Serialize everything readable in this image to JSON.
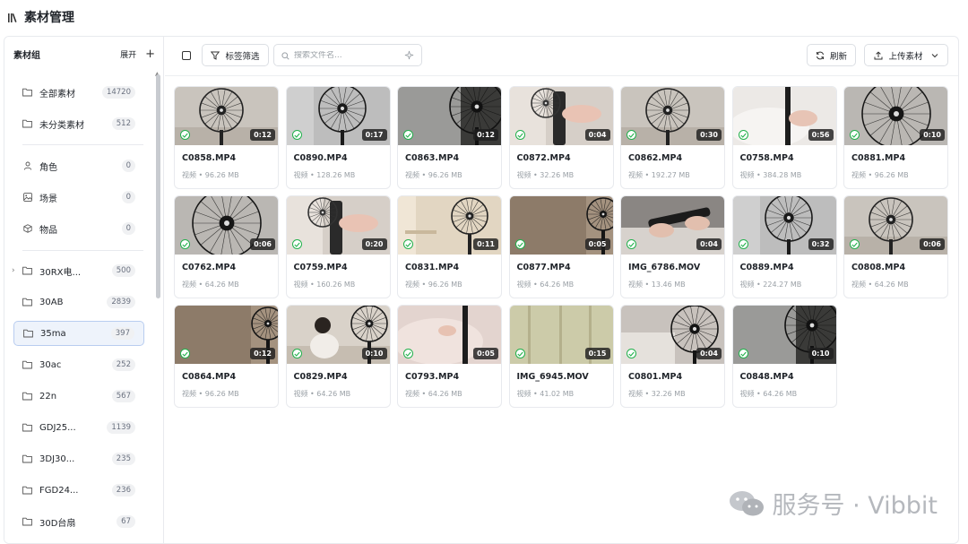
{
  "header": {
    "title": "素材管理"
  },
  "sidebar": {
    "title": "素材组",
    "expand_label": "展开",
    "add_label": "+",
    "items": [
      {
        "label": "全部素材",
        "count": "14720",
        "icon": "folder-icon"
      },
      {
        "label": "未分类素材",
        "count": "512",
        "icon": "folder-icon"
      },
      {
        "label": "角色",
        "count": "0",
        "icon": "person-icon"
      },
      {
        "label": "场景",
        "count": "0",
        "icon": "image-icon"
      },
      {
        "label": "物品",
        "count": "0",
        "icon": "box-icon"
      },
      {
        "label": "30RX电...",
        "count": "500",
        "icon": "folder-icon",
        "expandable": true
      },
      {
        "label": "30AB",
        "count": "2839",
        "icon": "folder-icon"
      },
      {
        "label": "35ma",
        "count": "397",
        "icon": "folder-icon",
        "active": true
      },
      {
        "label": "30ac",
        "count": "252",
        "icon": "folder-icon"
      },
      {
        "label": "22n",
        "count": "567",
        "icon": "folder-icon"
      },
      {
        "label": "GDJ25...",
        "count": "1139",
        "icon": "folder-icon"
      },
      {
        "label": "3DJ30...",
        "count": "235",
        "icon": "folder-icon"
      },
      {
        "label": "FGD24...",
        "count": "236",
        "icon": "folder-icon"
      },
      {
        "label": "30D台扇",
        "count": "67",
        "icon": "folder-icon"
      }
    ]
  },
  "toolbar": {
    "filter_label": "标签筛选",
    "search_placeholder": "搜索文件名...",
    "refresh_label": "刷新",
    "upload_label": "上传素材"
  },
  "cards": [
    {
      "name": "C0858.MP4",
      "meta": "视频 • 96.26 MB",
      "duration": "0:12",
      "scene": "fan-room"
    },
    {
      "name": "C0890.MP4",
      "meta": "视频 • 128.26 MB",
      "duration": "0:17",
      "scene": "fan-gray"
    },
    {
      "name": "C0863.MP4",
      "meta": "视频 • 96.26 MB",
      "duration": "0:12",
      "scene": "fan-dark"
    },
    {
      "name": "C0872.MP4",
      "meta": "视频 • 32.26 MB",
      "duration": "0:04",
      "scene": "hand-fan"
    },
    {
      "name": "C0862.MP4",
      "meta": "视频 • 192.27 MB",
      "duration": "0:30",
      "scene": "fan-room"
    },
    {
      "name": "C0758.MP4",
      "meta": "视频 • 384.28 MB",
      "duration": "0:56",
      "scene": "bed-pole"
    },
    {
      "name": "C0881.MP4",
      "meta": "视频 • 96.26 MB",
      "duration": "0:10",
      "scene": "fan-close"
    },
    {
      "name": "C0762.MP4",
      "meta": "视频 • 64.26 MB",
      "duration": "0:06",
      "scene": "fan-close"
    },
    {
      "name": "C0759.MP4",
      "meta": "视频 • 160.26 MB",
      "duration": "0:20",
      "scene": "hand-fan"
    },
    {
      "name": "C0831.MP4",
      "meta": "视频 • 96.26 MB",
      "duration": "0:11",
      "scene": "fan-warm"
    },
    {
      "name": "C0877.MP4",
      "meta": "视频 • 64.26 MB",
      "duration": "0:05",
      "scene": "fan-brown"
    },
    {
      "name": "IMG_6786.MOV",
      "meta": "视频 • 13.46 MB",
      "duration": "0:04",
      "scene": "hands"
    },
    {
      "name": "C0889.MP4",
      "meta": "视频 • 224.27 MB",
      "duration": "0:32",
      "scene": "fan-gray"
    },
    {
      "name": "C0808.MP4",
      "meta": "视频 • 64.26 MB",
      "duration": "0:06",
      "scene": "fan-room"
    },
    {
      "name": "C0864.MP4",
      "meta": "视频 • 96.26 MB",
      "duration": "0:12",
      "scene": "fan-brown"
    },
    {
      "name": "C0829.MP4",
      "meta": "视频 • 64.26 MB",
      "duration": "0:10",
      "scene": "person-fan"
    },
    {
      "name": "C0793.MP4",
      "meta": "视频 • 64.26 MB",
      "duration": "0:05",
      "scene": "pink"
    },
    {
      "name": "IMG_6945.MOV",
      "meta": "视频 • 41.02 MB",
      "duration": "0:15",
      "scene": "curtain"
    },
    {
      "name": "C0801.MP4",
      "meta": "视频 • 32.26 MB",
      "duration": "0:04",
      "scene": "fan-sofa"
    },
    {
      "name": "C0848.MP4",
      "meta": "视频 • 64.26 MB",
      "duration": "0:10",
      "scene": "fan-dark"
    }
  ],
  "watermark": {
    "text": "服务号 · Vibbit"
  },
  "colors": {
    "accent": "#3b6fd8",
    "success": "#22b14c",
    "active_bg": "#eef3fb"
  }
}
